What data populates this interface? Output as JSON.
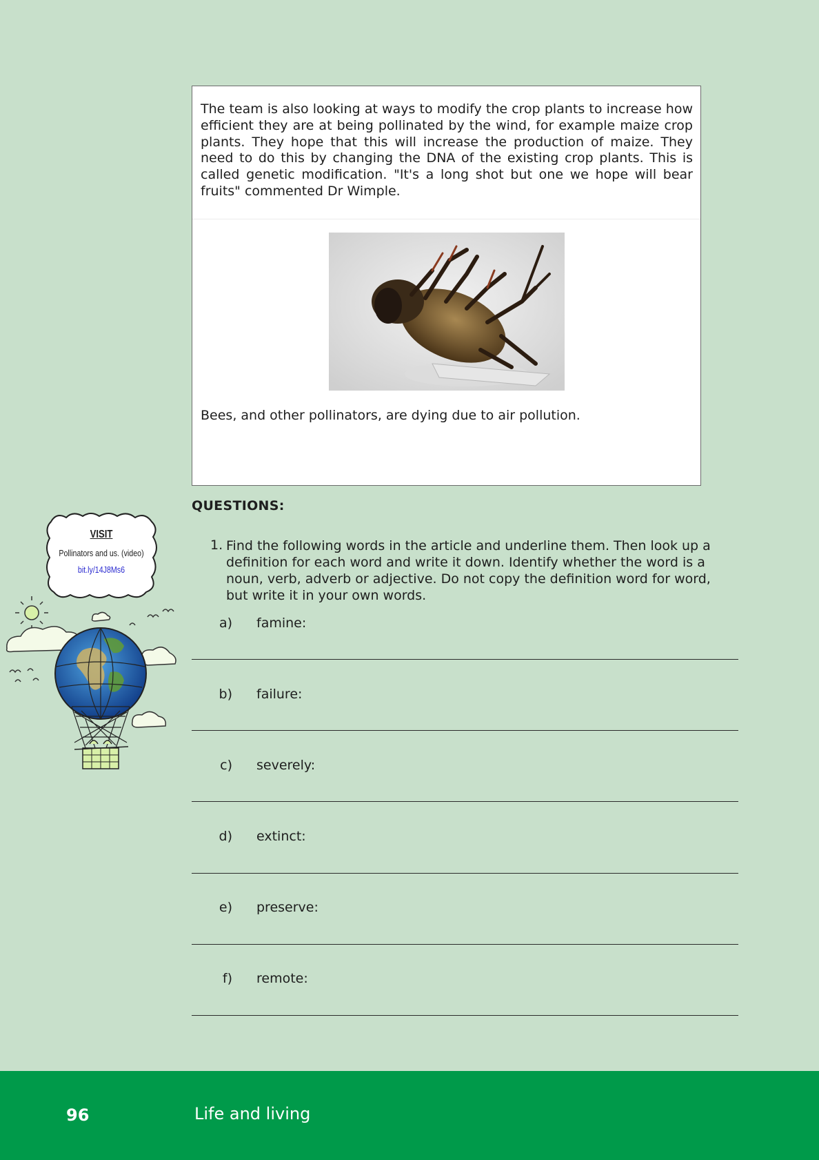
{
  "article": {
    "paragraph": "The team is also looking at ways to modify the crop plants to increase how efficient they are at being pollinated by the wind, for example maize crop plants.  They hope that this will increase the production of maize. They need to do this by changing the DNA of the existing crop plants. This is called genetic modification. \"It's a long shot but one we hope will bear fruits\" commented Dr Wimple.",
    "caption": "Bees, and other pollinators, are dying due to air pollution."
  },
  "questions": {
    "heading": "QUESTIONS:",
    "q1": {
      "number": "1.",
      "text": "Find the following words in the article and underline them. Then look up a definition for each word and write it down. Identify whether the word is a noun, verb, adverb or adjective. Do not copy the definition word for word, but write it in your own words.",
      "items": [
        {
          "label": "a)",
          "word": "famine:"
        },
        {
          "label": "b)",
          "word": "failure:"
        },
        {
          "label": "c)",
          "word": "severely:"
        },
        {
          "label": "d)",
          "word": "extinct:"
        },
        {
          "label": "e)",
          "word": "preserve:"
        },
        {
          "label": "f)",
          "word": "remote:"
        }
      ]
    }
  },
  "visit": {
    "title": "VISIT",
    "description": "Pollinators and us. (video)",
    "link": "bit.ly/14J8Ms6"
  },
  "footer": {
    "page_number": "96",
    "section_title": "Life and living",
    "color": "#009a4a"
  }
}
